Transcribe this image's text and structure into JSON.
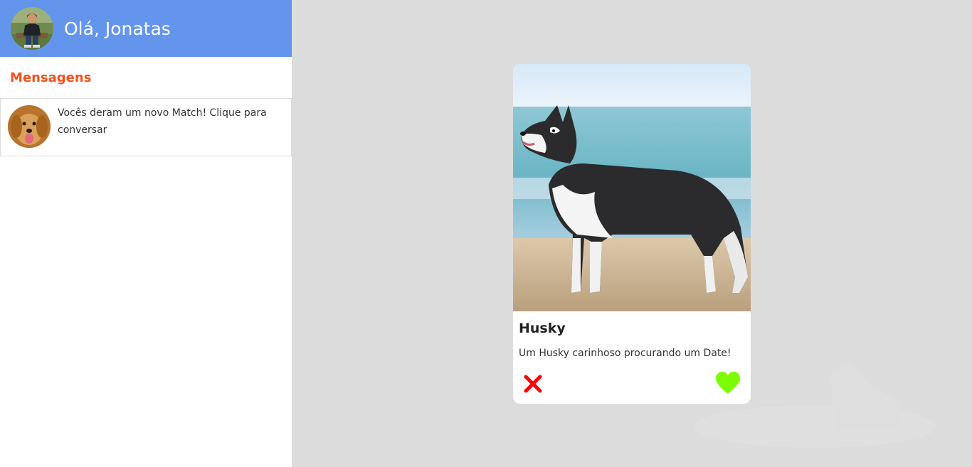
{
  "header": {
    "greeting": "Olá, Jonatas",
    "avatar_icon": "user-avatar-photo"
  },
  "messages": {
    "title": "Mensagens",
    "items": [
      {
        "text": "Vocês deram um novo Match! Clique para conversar",
        "avatar_icon": "golden-retriever-avatar"
      }
    ]
  },
  "card": {
    "name": "Husky",
    "description": "Um Husky carinhoso procurando um Date!",
    "photo_icon": "husky-photo",
    "dislike_icon": "close-x-icon",
    "like_icon": "heart-icon"
  },
  "colors": {
    "header_bg": "#6495ed",
    "section_title": "#f4511e",
    "main_bg": "#dcdcdc",
    "dislike": "#ff0000",
    "like": "#7cfc00"
  }
}
